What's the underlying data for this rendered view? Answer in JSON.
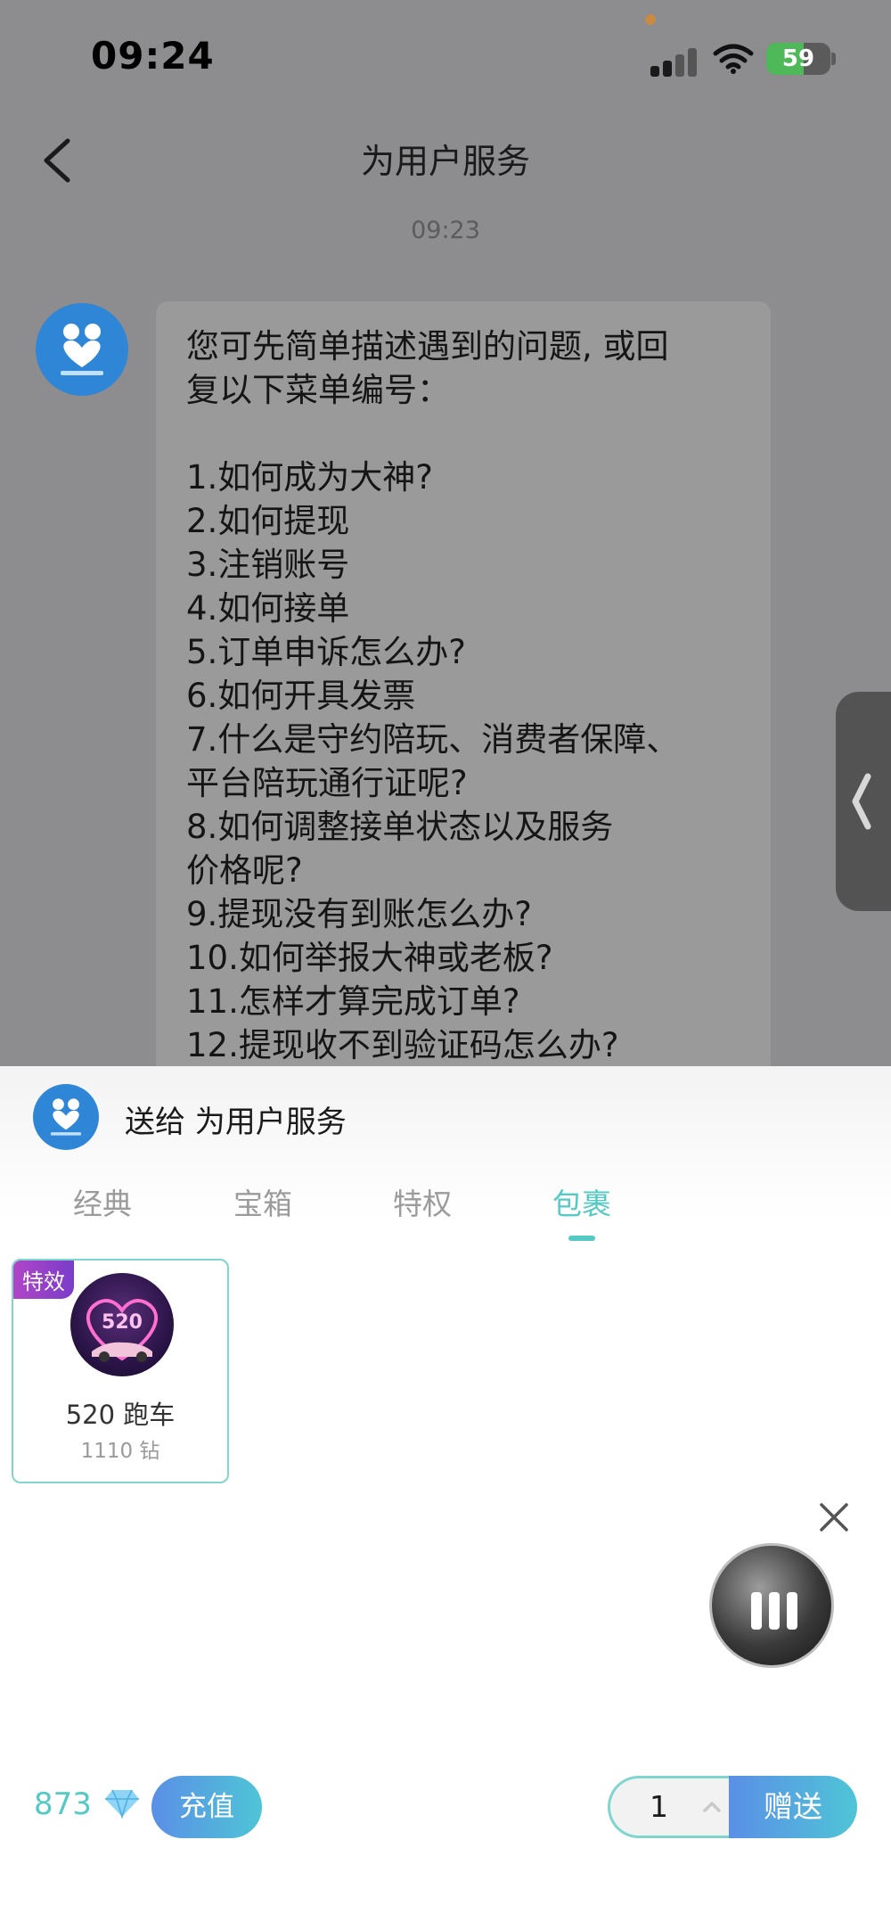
{
  "status_bar": {
    "time": "09:24",
    "battery": "59",
    "battery_level": 0.59,
    "icons": [
      "signal-icon",
      "wifi-icon",
      "battery-icon"
    ]
  },
  "nav": {
    "title": "为用户服务",
    "back_icon": "chevron-left-icon"
  },
  "chat": {
    "timestamp": "09:23",
    "message_lines": [
      "您可先简单描述遇到的问题, 或回",
      "复以下菜单编号：",
      "",
      "1.如何成为大神?",
      "2.如何提现",
      "3.注销账号",
      "4.如何接单",
      "5.订单申诉怎么办?",
      "6.如何开具发票",
      "7.什么是守约陪玩、消费者保障、",
      "平台陪玩通行证呢?",
      "8.如何调整接单状态以及服务",
      "价格呢?",
      "9.提现没有到账怎么办?",
      "10.如何举报大神或老板?",
      "11.怎样才算完成订单?",
      "12.提现收不到验证码怎么办?"
    ]
  },
  "gift_panel": {
    "send_to": "送给 为用户服务",
    "tabs": [
      {
        "label": "经典",
        "active": false
      },
      {
        "label": "宝箱",
        "active": false
      },
      {
        "label": "特权",
        "active": false
      },
      {
        "label": "包裹",
        "active": true
      }
    ],
    "items": [
      {
        "badge": "特效",
        "name": "520 跑车",
        "price": "1110 钻",
        "selected": true
      }
    ],
    "balance": "873",
    "recharge_label": "充值",
    "quantity": "1",
    "give_label": "赠送"
  },
  "colors": {
    "accent": "#55c9c4",
    "button_gradient_start": "#5a8fe6",
    "button_gradient_end": "#4fc5d6",
    "overlay": "#8d8d8f"
  }
}
